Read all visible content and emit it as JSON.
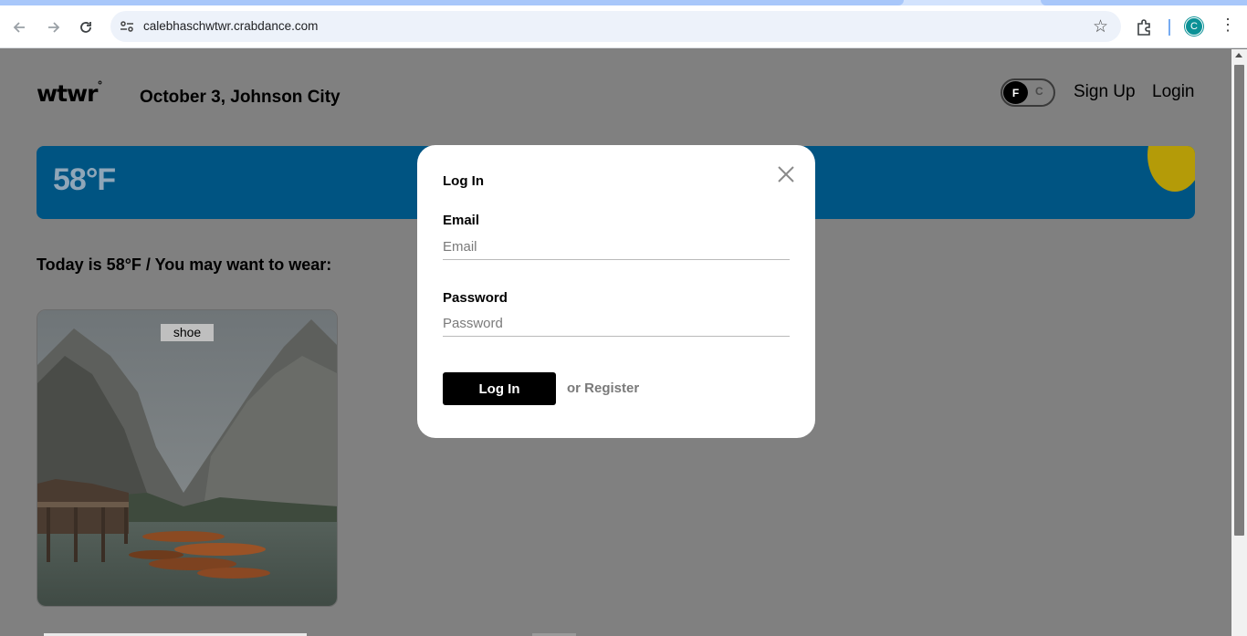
{
  "browser": {
    "url": "calebhaschwtwr.crabdance.com",
    "profile_initial": "C",
    "icons": [
      "back-icon",
      "forward-icon",
      "reload-icon",
      "site-info-icon",
      "bookmark-star-icon",
      "extensions-icon",
      "menu-icon"
    ]
  },
  "header": {
    "logo": "wtwr",
    "logo_mark": "°",
    "date_location": "October 3, Johnson City",
    "toggle_f": "F",
    "toggle_c": "C",
    "signup_label": "Sign Up",
    "login_label": "Login"
  },
  "weather": {
    "temperature": "58°F"
  },
  "main": {
    "today_text": "Today is 58°F / You may want to wear:",
    "items": [
      {
        "label": "shoe"
      }
    ]
  },
  "modal": {
    "title": "Log In",
    "email_label": "Email",
    "email_placeholder": "Email",
    "password_label": "Password",
    "password_placeholder": "Password",
    "submit_label": "Log In",
    "register_label": "or Register"
  }
}
